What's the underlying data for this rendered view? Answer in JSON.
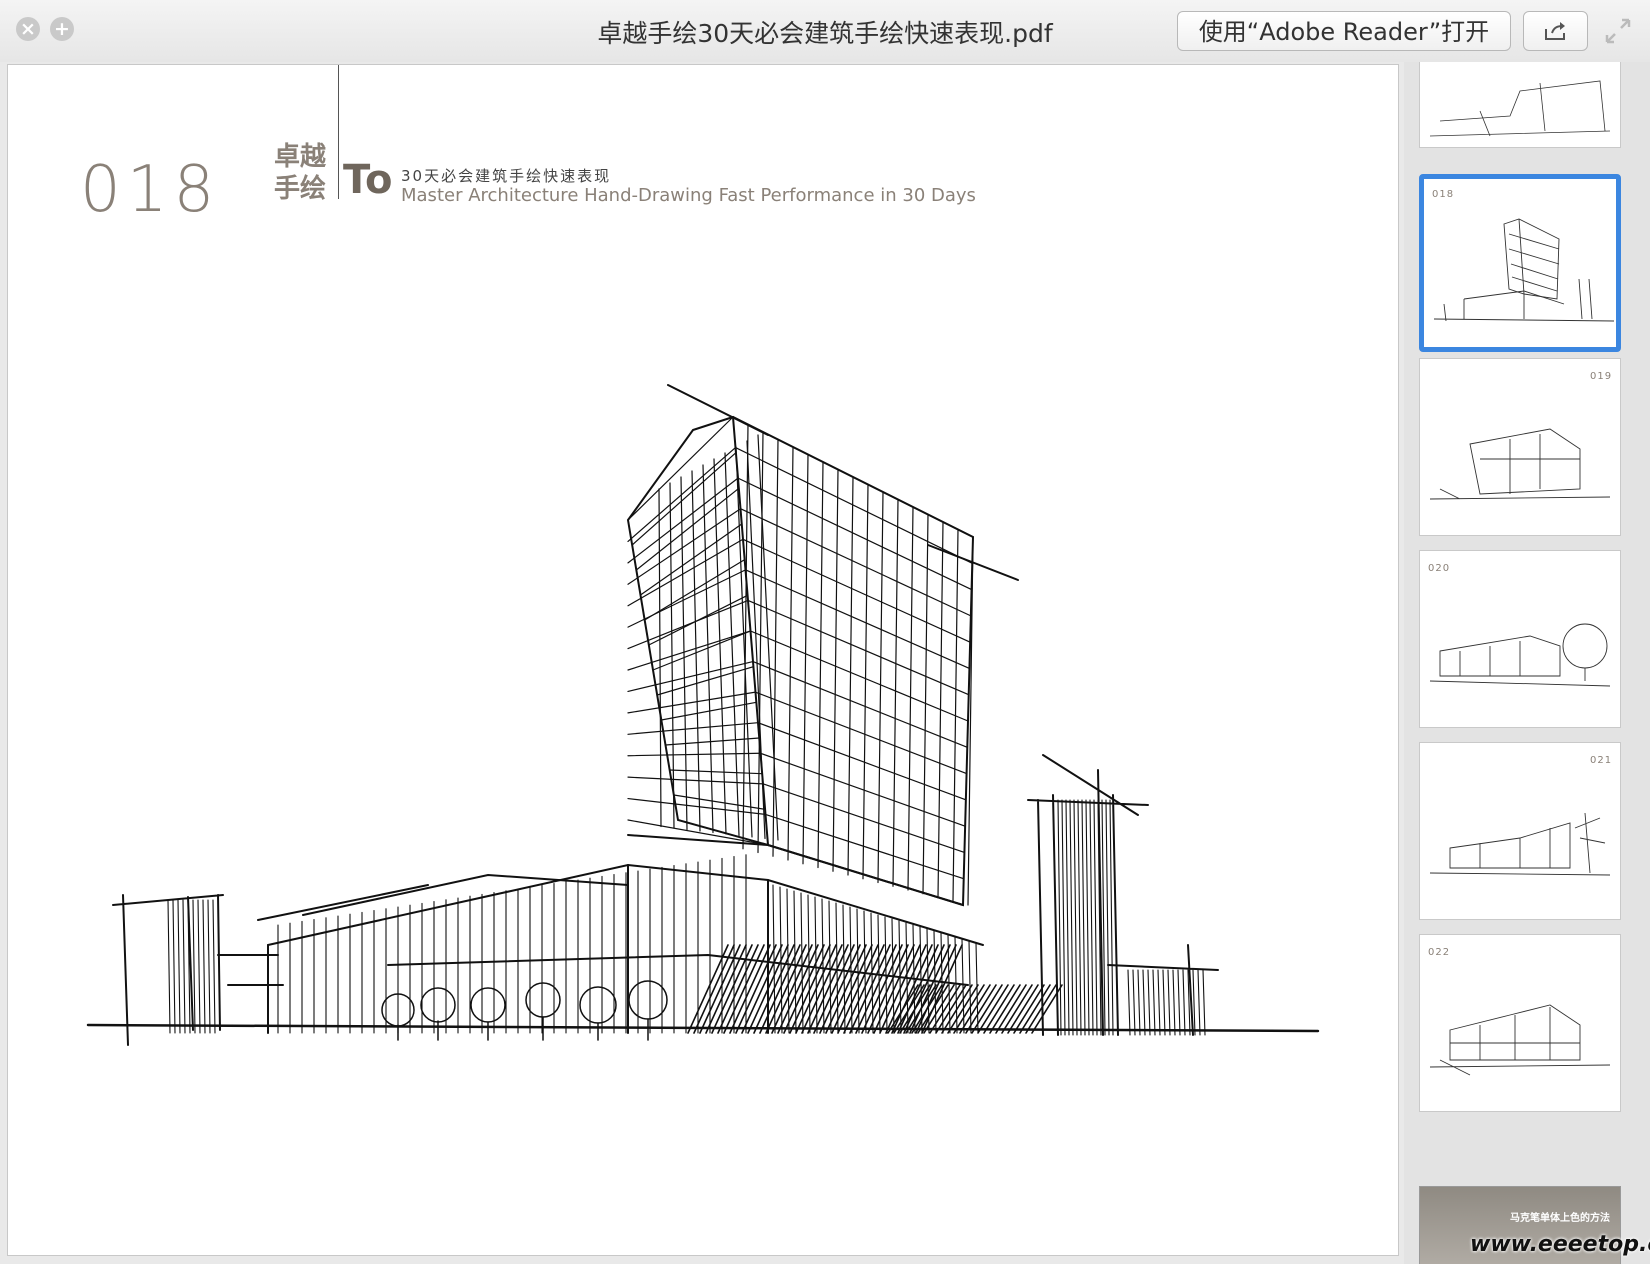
{
  "window": {
    "title": "卓越手绘30天必会建筑手绘快速表现.pdf",
    "open_with_label": "使用“Adobe Reader”打开",
    "close_icon": "close-icon",
    "add_icon": "plus-icon",
    "share_icon": "share-icon",
    "fullscreen_icon": "fullscreen-icon"
  },
  "page": {
    "number": "018",
    "brand_line1": "卓越",
    "brand_line2": "手绘",
    "to_mark": "To",
    "subtitle_cn": "30天必会建筑手绘快速表现",
    "subtitle_en": "Master Architecture Hand-Drawing Fast Performance in 30 Days",
    "illustration": "architectural-sketch"
  },
  "thumbnails": [
    {
      "number": "",
      "selected": false
    },
    {
      "number": "018",
      "selected": true
    },
    {
      "number": "019",
      "selected": false
    },
    {
      "number": "020",
      "selected": false
    },
    {
      "number": "021",
      "selected": false
    },
    {
      "number": "022",
      "selected": false
    }
  ],
  "last_thumbnail": {
    "label": "马克笔单体上色的方法"
  },
  "watermark": "www.eeeetop.com",
  "colors": {
    "selection": "#3b86e0",
    "brand_gray": "#8a8178"
  }
}
